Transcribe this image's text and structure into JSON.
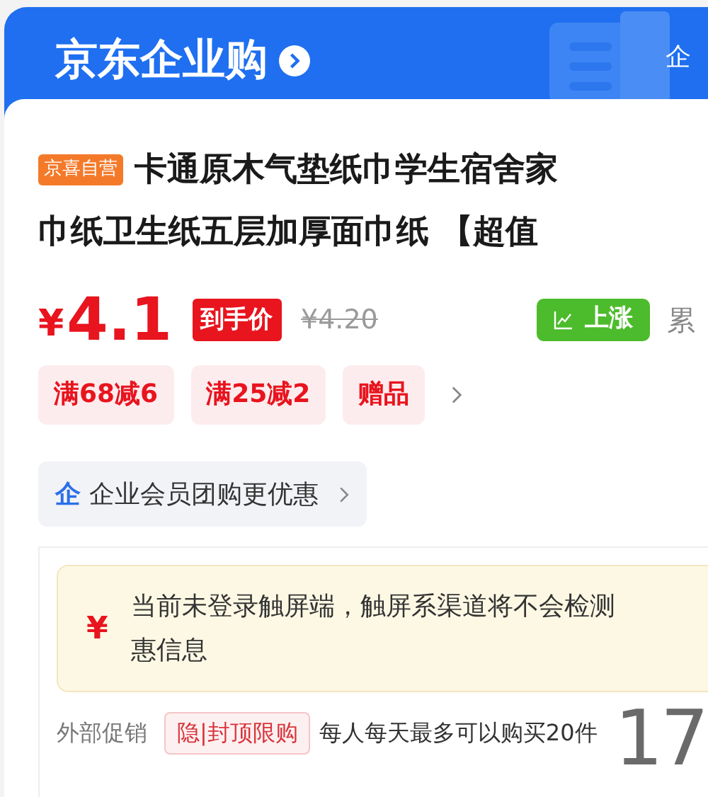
{
  "header": {
    "title": "京东企业购",
    "right_text": "企"
  },
  "product": {
    "badge": "京喜自营",
    "title_lines": [
      "卡通原木气垫纸巾学生宿舍家",
      "巾纸卫生纸五层加厚面巾纸 【超值"
    ]
  },
  "price": {
    "currency": "¥",
    "amount": "4.1",
    "label": "到手价",
    "original": "¥4.20",
    "trend": "上涨",
    "trend_suffix": "累"
  },
  "promotions": [
    {
      "label": "满68减6"
    },
    {
      "label": "满25减2"
    },
    {
      "label": "赠品"
    }
  ],
  "member_banner": {
    "icon_text": "企",
    "label": "企业会员团购更优惠"
  },
  "notice": {
    "icon_text": "¥",
    "lines": [
      "当前未登录触屏端，触屏系渠道将不会检测",
      "惠信息"
    ]
  },
  "external_promo": {
    "label": "外部促销",
    "tag": "隐|封顶限购",
    "text": "每人每天最多可以购买20件"
  },
  "overlay_number": "17"
}
